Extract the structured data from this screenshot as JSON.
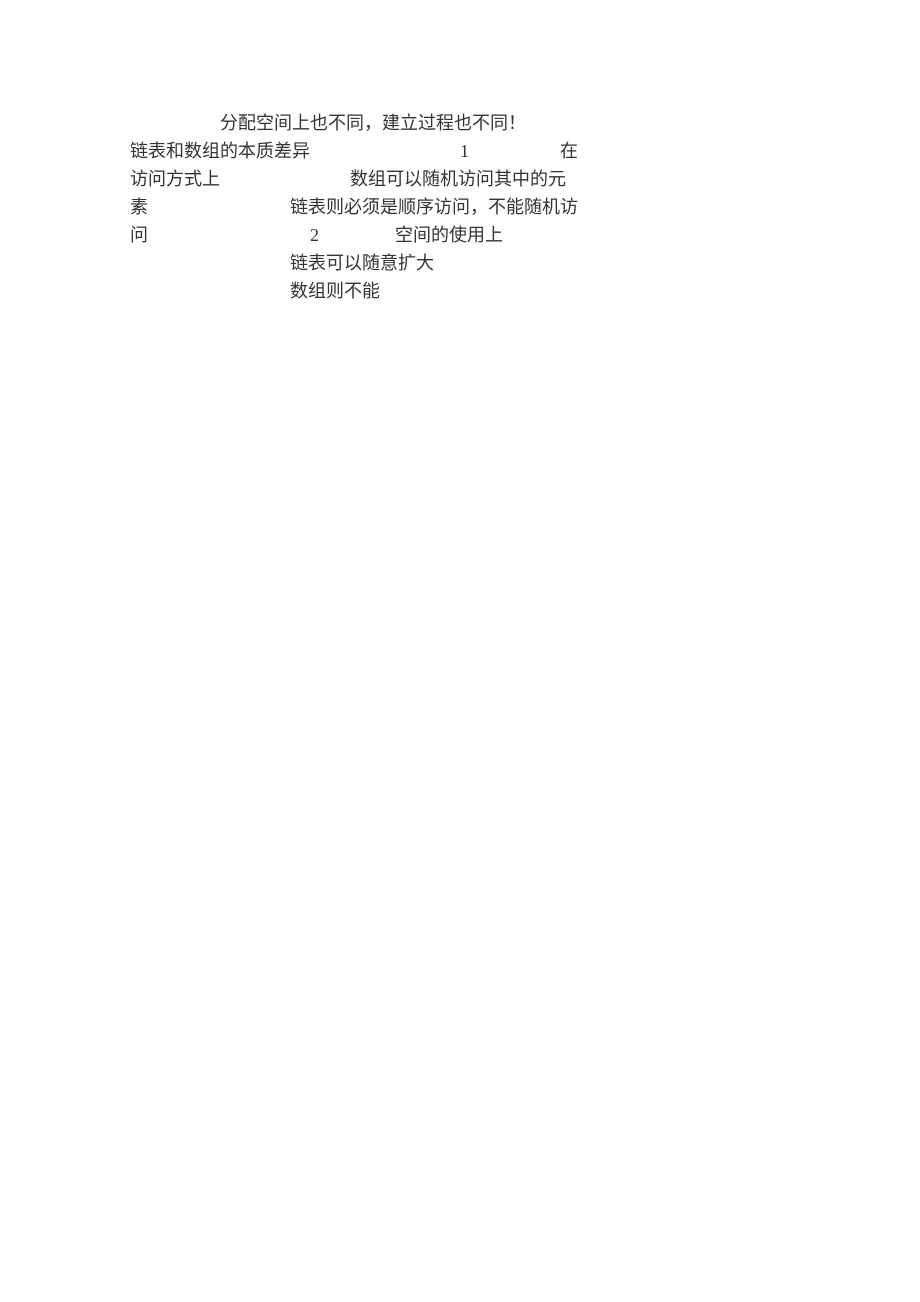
{
  "doc": {
    "lines": {
      "l1": "分配空间上也不同，建立过程也不同！",
      "l2a": "链表和数组的本质差异",
      "l2b": "1",
      "l2c": "在",
      "l3a": "访问方式上",
      "l3b": "数组可以随机访问其中的元",
      "l4a": "素",
      "l4b": "链表则必须是顺序访问，不能随机访",
      "l5a": "问",
      "l5b": "2",
      "l5c": "空间的使用上",
      "l6": "链表可以随意扩大",
      "l7": "数组则不能"
    }
  }
}
